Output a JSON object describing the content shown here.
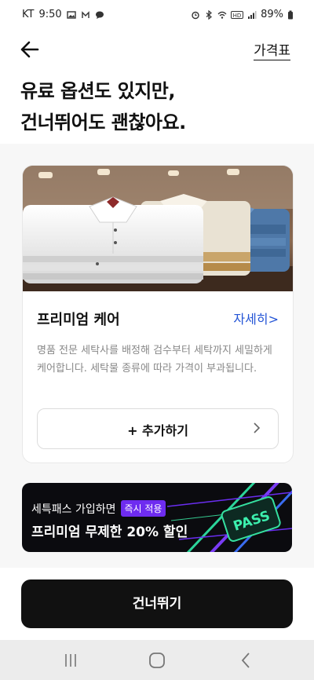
{
  "status": {
    "carrier": "KT",
    "time": "9:50",
    "battery": "89%"
  },
  "header": {
    "price_link": "가격표"
  },
  "hero": {
    "title": "유료 옵션도 있지만,\n건너뛰어도 괜찮아요."
  },
  "card": {
    "title": "프리미엄 케어",
    "detail_link": "자세히>",
    "description": "명품 전문 세탁사를 배정해 검수부터 세탁까지 세밀하게 케어합니다. 세탁물 종류에 따라 가격이 부과됩니다.",
    "add_label": "+ 추가하기"
  },
  "banner": {
    "line1": "세특패스 가입하면",
    "badge": "즉시 적용",
    "line2": "프리미엄 무제한 20% 할인",
    "pass_text": "PASS"
  },
  "bottom": {
    "skip_label": "건너뛰기"
  }
}
